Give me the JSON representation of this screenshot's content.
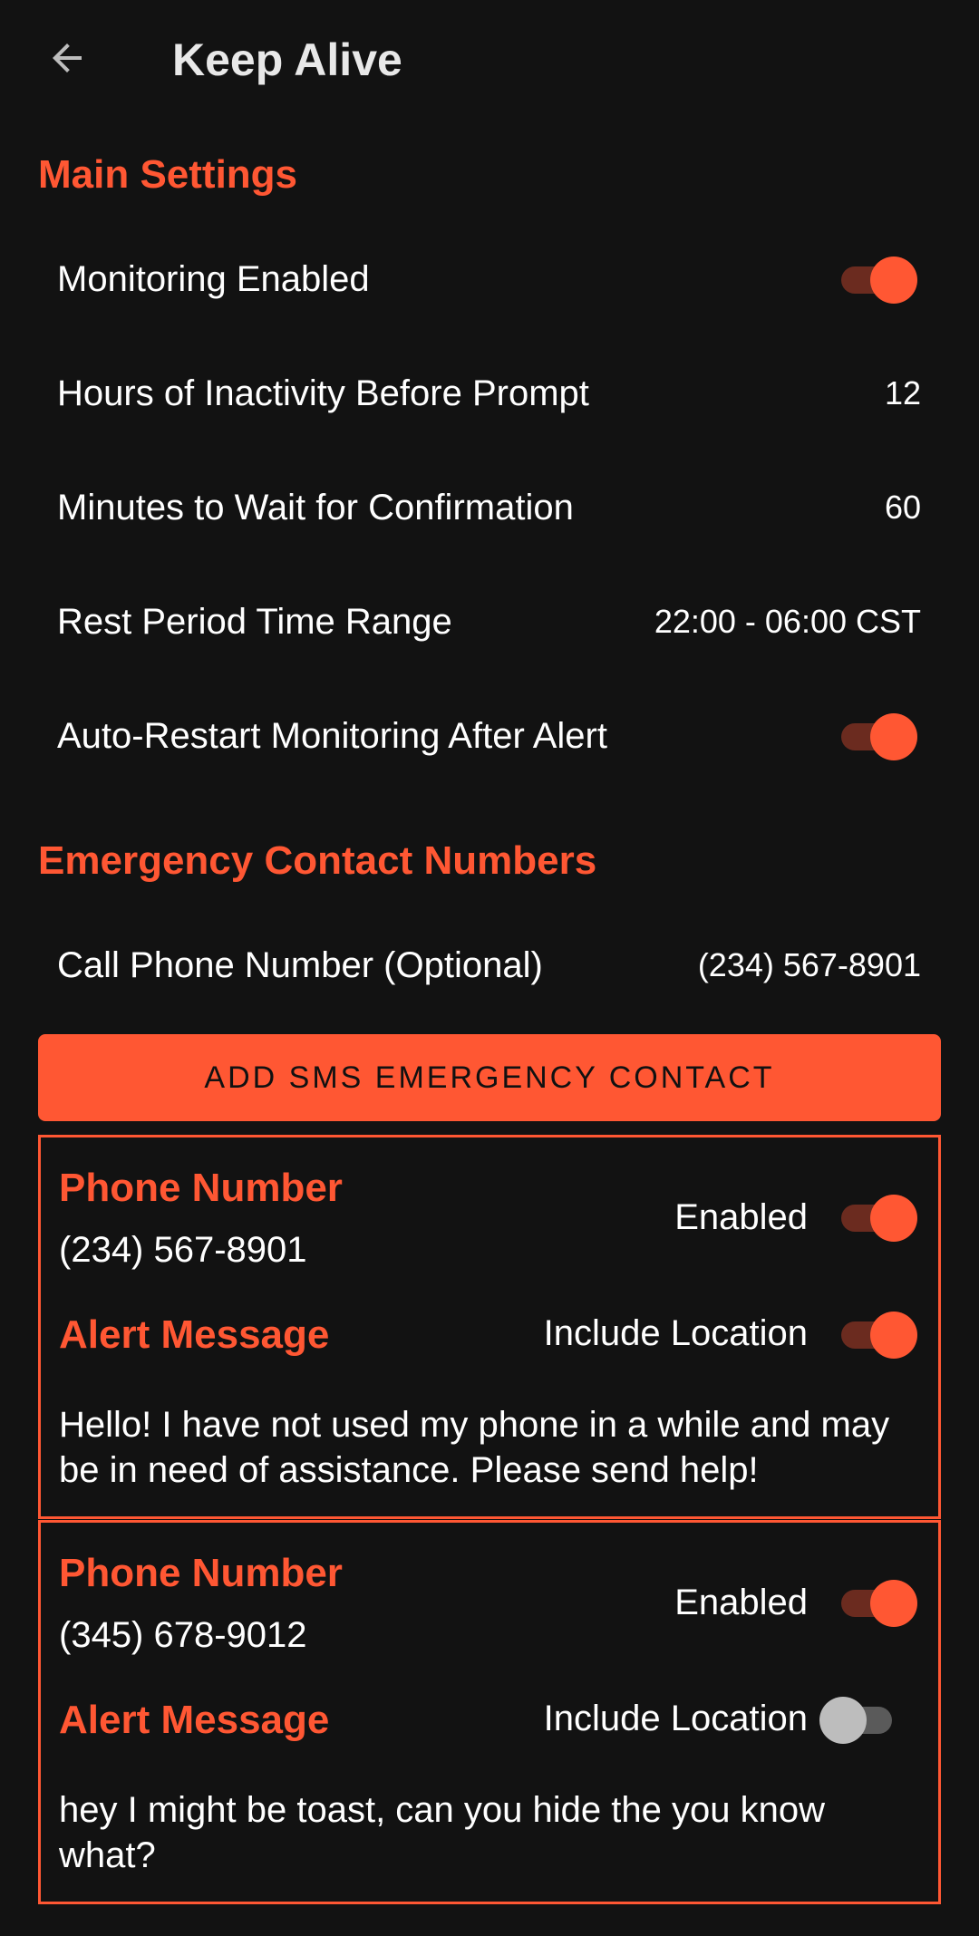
{
  "app_bar": {
    "back_icon": "arrow-back-icon",
    "title": "Keep Alive"
  },
  "main_settings": {
    "section_title": "Main Settings",
    "monitoring_enabled": {
      "label": "Monitoring Enabled",
      "checked": true
    },
    "hours_inactivity": {
      "label": "Hours of Inactivity Before Prompt",
      "value": "12"
    },
    "minutes_wait": {
      "label": "Minutes to Wait for Confirmation",
      "value": "60"
    },
    "rest_period": {
      "label": "Rest Period Time Range",
      "value": "22:00 - 06:00 CST"
    },
    "auto_restart": {
      "label": "Auto-Restart Monitoring After Alert",
      "checked": true
    }
  },
  "emergency": {
    "section_title": "Emergency Contact Numbers",
    "call_phone": {
      "label": "Call Phone Number (Optional)",
      "value": "(234) 567-8901"
    },
    "add_sms_button": "ADD SMS EMERGENCY CONTACT"
  },
  "contacts": [
    {
      "phone_label": "Phone Number",
      "phone": "(234) 567-8901",
      "enabled_label": "Enabled",
      "enabled": true,
      "message_label": "Alert Message",
      "include_location_label": "Include Location",
      "include_location": true,
      "message": "Hello! I have not used my phone in a while and may be in need of assistance. Please send help!"
    },
    {
      "phone_label": "Phone Number",
      "phone": "(345) 678-9012",
      "enabled_label": "Enabled",
      "enabled": true,
      "message_label": "Alert Message",
      "include_location_label": "Include Location",
      "include_location": false,
      "message": "hey I might be toast, can you hide the you know what?"
    }
  ],
  "colors": {
    "background": "#121212",
    "accent": "#ff5733",
    "text": "#ffffff"
  }
}
